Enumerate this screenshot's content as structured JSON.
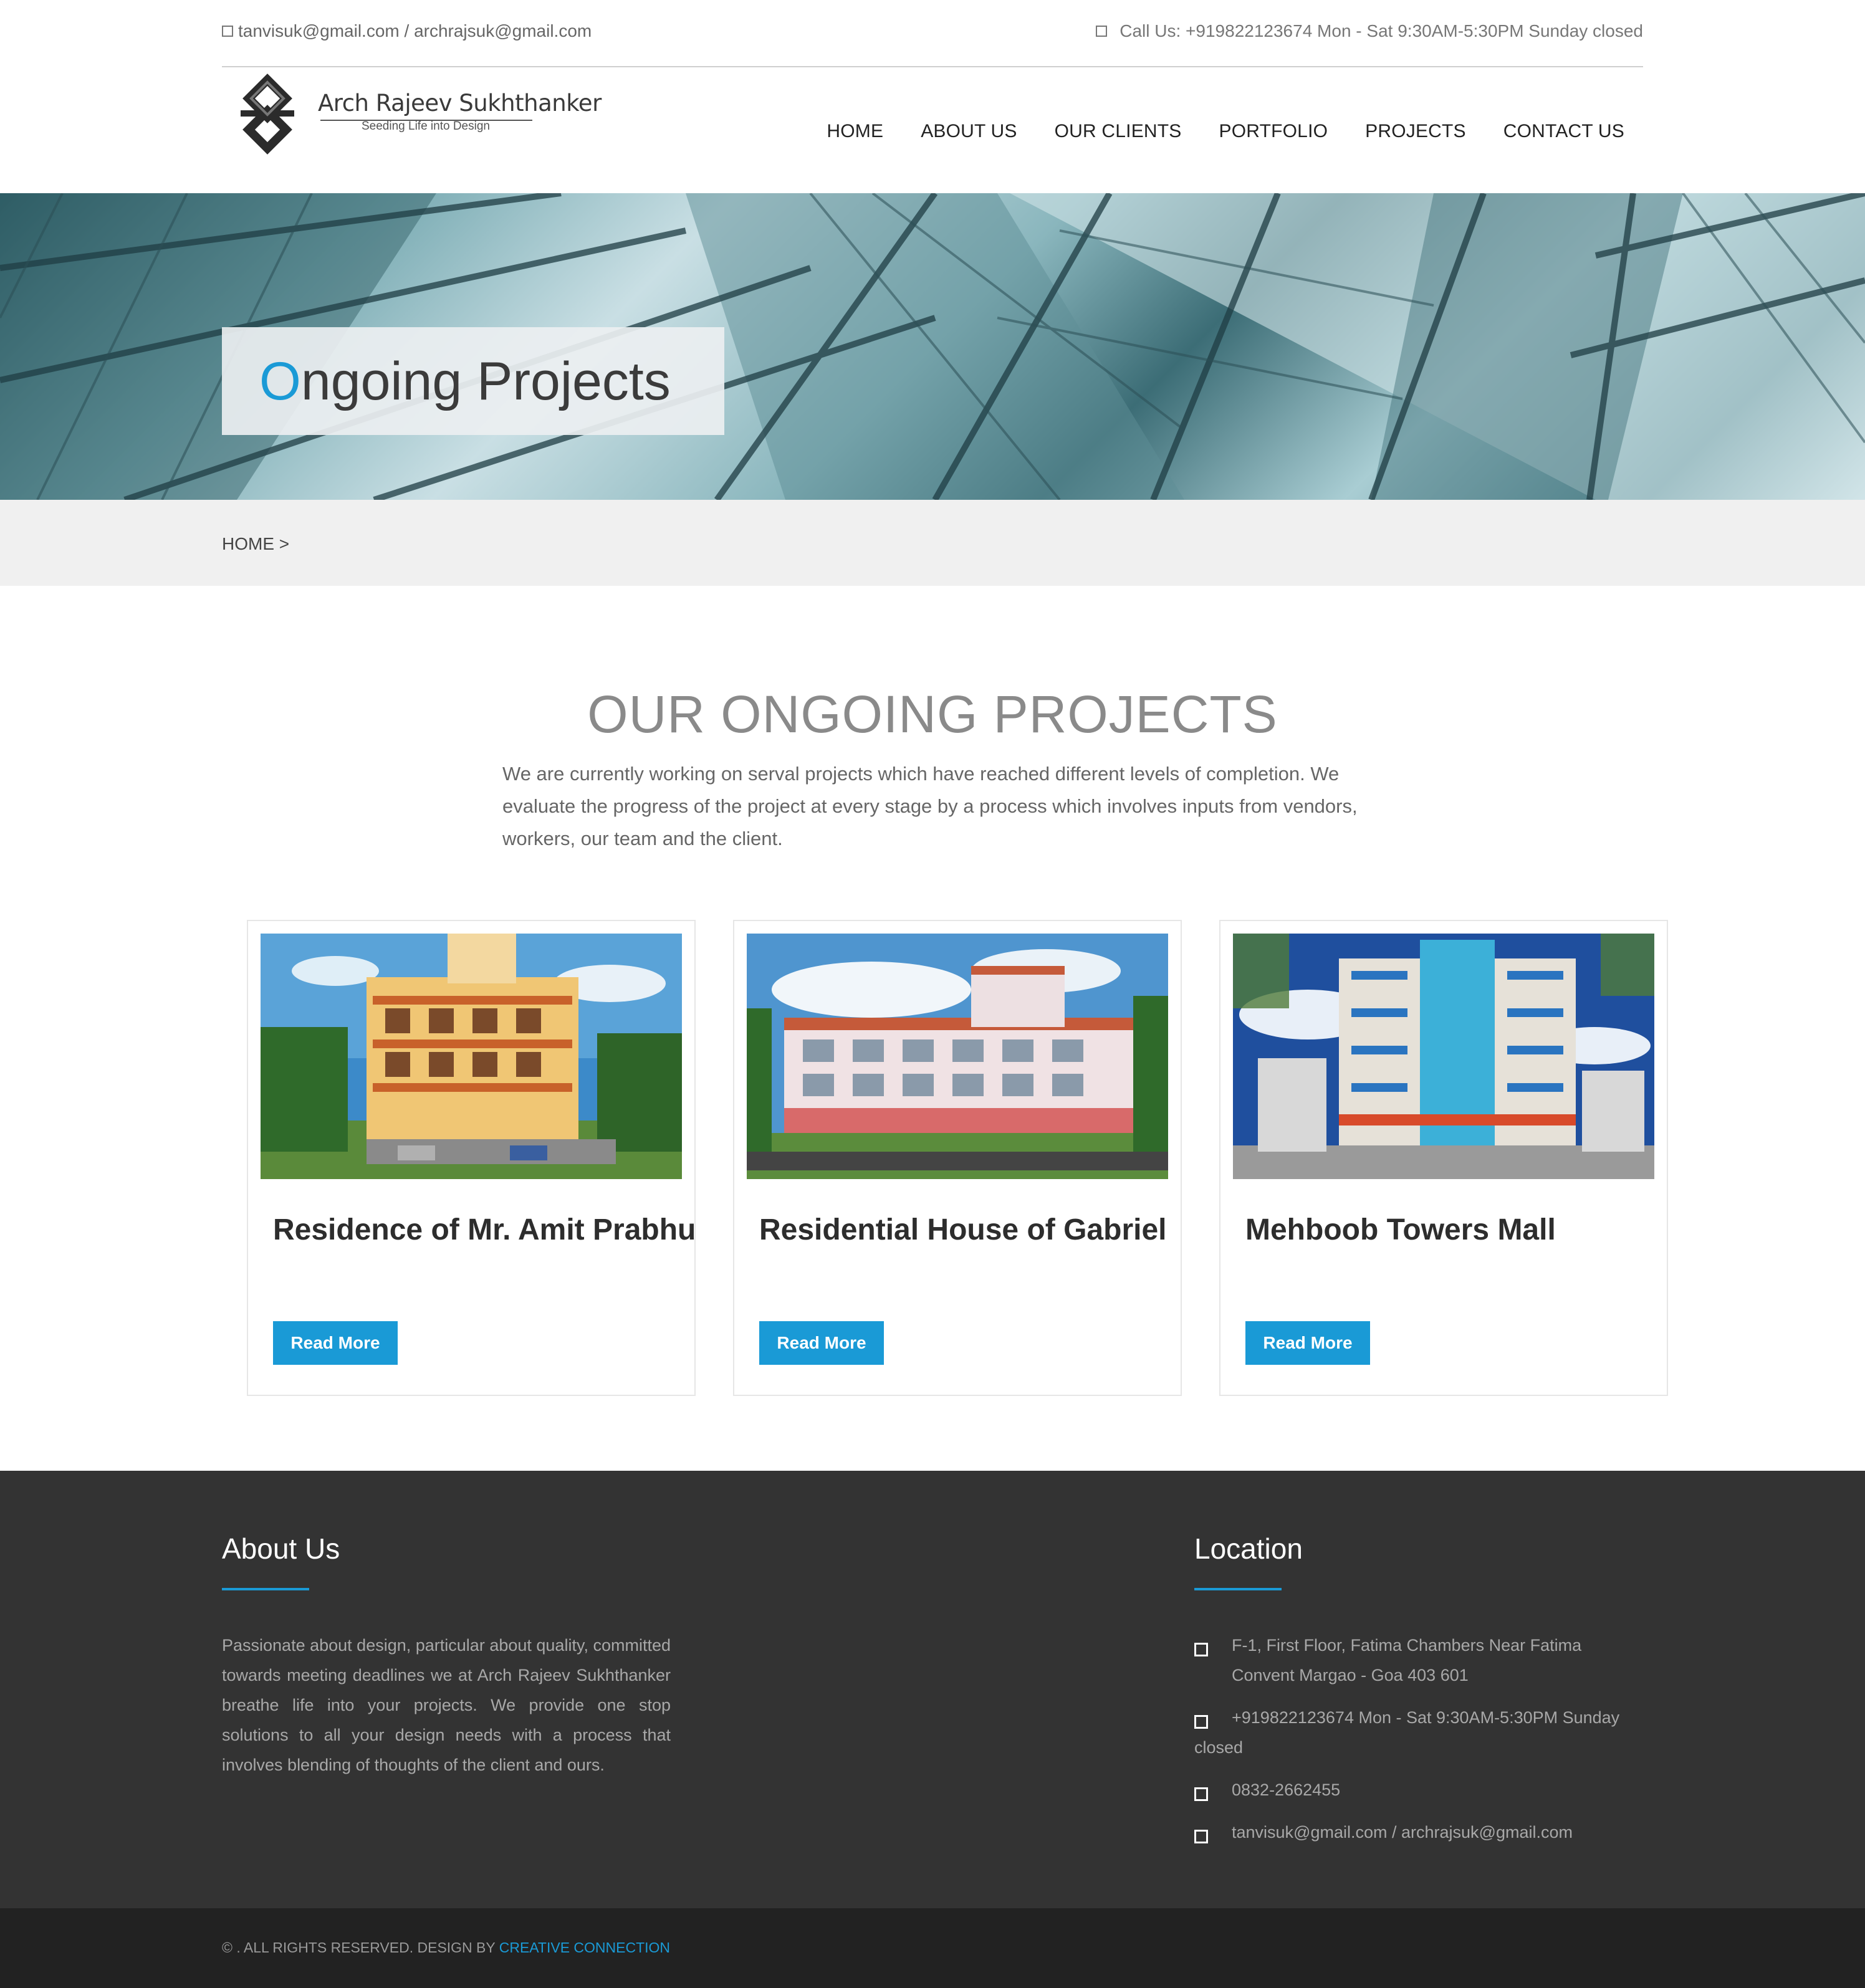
{
  "topbar": {
    "email": "tanvisuk@gmail.com / archrajsuk@gmail.com",
    "phone": "Call Us: +919822123674 Mon - Sat 9:30AM-5:30PM Sunday closed"
  },
  "logo": {
    "name": "Arch Rajeev Sukhthanker",
    "tagline": "Seeding Life into Design"
  },
  "nav": [
    "HOME",
    "ABOUT US",
    "OUR CLIENTS",
    "PORTFOLIO",
    "PROJECTS",
    "CONTACT US"
  ],
  "hero": {
    "title_first": "O",
    "title_rest": "ngoing Projects"
  },
  "breadcrumb": "HOME >",
  "section": {
    "title": "OUR ONGOING PROJECTS",
    "description": "We are currently working on serval projects which have reached different levels of completion. We evaluate the progress of the project at every stage by a process which involves inputs from vendors, workers, our team and the client."
  },
  "projects": [
    {
      "title": "Residence of Mr. Amit Prabhu",
      "button": "Read More"
    },
    {
      "title": "Residential House of Gabriel",
      "button": "Read More"
    },
    {
      "title": "Mehboob Towers Mall",
      "button": "Read More"
    }
  ],
  "footer": {
    "about_title": "About Us",
    "about_text": "Passionate about design, particular about quality, committed towards meeting deadlines we at Arch Rajeev Sukhthanker breathe life into your projects. We provide one stop solutions to all your design needs with a process that involves blending of thoughts of the client and ours.",
    "location_title": "Location",
    "location": [
      "F-1, First Floor, Fatima Chambers Near Fatima Convent Margao - Goa 403 601",
      "+919822123674 Mon - Sat 9:30AM-5:30PM Sunday closed",
      "0832-2662455",
      "tanvisuk@gmail.com / archrajsuk@gmail.com"
    ]
  },
  "copyright": {
    "text": "© . ALL RIGHTS RESERVED. DESIGN BY ",
    "link": "CREATIVE CONNECTION"
  },
  "colors": {
    "accent": "#1a9ad6",
    "footer_bg": "#333333",
    "copyright_bg": "#222222"
  }
}
